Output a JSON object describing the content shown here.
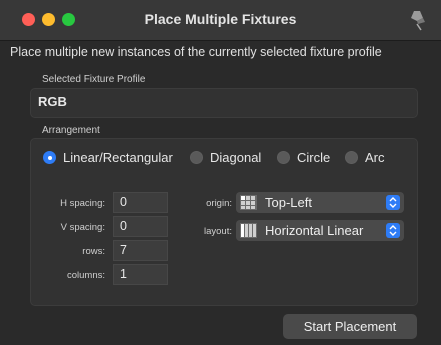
{
  "window": {
    "title": "Place Multiple Fixtures"
  },
  "description": "Place multiple new instances of the currently selected fixture profile",
  "profile": {
    "label": "Selected Fixture Profile",
    "value": "RGB"
  },
  "arrangement": {
    "label": "Arrangement",
    "options": [
      {
        "label": "Linear/Rectangular",
        "selected": true
      },
      {
        "label": "Diagonal",
        "selected": false
      },
      {
        "label": "Circle",
        "selected": false
      },
      {
        "label": "Arc",
        "selected": false
      }
    ]
  },
  "fields": {
    "h_spacing": {
      "label": "H spacing:",
      "value": "0"
    },
    "v_spacing": {
      "label": "V spacing:",
      "value": "0"
    },
    "rows": {
      "label": "rows:",
      "value": "7"
    },
    "columns": {
      "label": "columns:",
      "value": "1"
    }
  },
  "origin": {
    "label": "origin:",
    "value": "Top-Left"
  },
  "layout": {
    "label": "layout:",
    "value": "Horizontal Linear"
  },
  "start_button": "Start Placement",
  "colors": {
    "accent": "#2e7cf6",
    "close": "#ff5f57",
    "minimize": "#febc2e",
    "maximize": "#28c840"
  }
}
